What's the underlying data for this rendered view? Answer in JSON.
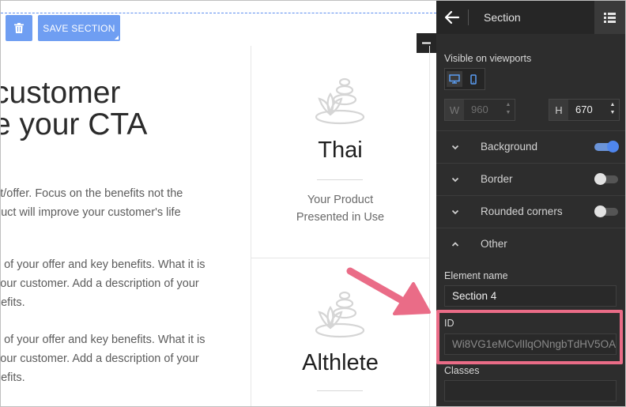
{
  "toolbar": {
    "save_label": "SAVE SECTION"
  },
  "canvas": {
    "headline_lines": [
      "customer",
      "e your CTA"
    ],
    "paragraphs": [
      [
        "ct/offer. Focus on the benefits not the",
        "duct will improve your customer's life"
      ],
      [
        "n of your offer and key benefits. What it is",
        "your customer. Add a description of your",
        "nefits."
      ],
      [
        "n of your offer and key benefits. What it is",
        "your customer. Add a description of your",
        "nefits."
      ]
    ],
    "cards": [
      {
        "title": "Thai",
        "subtitle_lines": [
          "Your Product",
          "Presented in Use"
        ]
      },
      {
        "title": "Althlete"
      }
    ]
  },
  "panel": {
    "title": "Section",
    "visible_on_viewports_label": "Visible on viewports",
    "width": {
      "label": "W",
      "value": "960"
    },
    "height": {
      "label": "H",
      "value": "670"
    },
    "accordions": [
      {
        "label": "Background",
        "toggle": "on",
        "expanded": false
      },
      {
        "label": "Border",
        "toggle": "off",
        "expanded": false
      },
      {
        "label": "Rounded corners",
        "toggle": "off",
        "expanded": false
      },
      {
        "label": "Other",
        "expanded": true
      }
    ],
    "element_name": {
      "label": "Element name",
      "value": "Section 4"
    },
    "id": {
      "label": "ID",
      "placeholder": "Wi8VG1eMCvlIlqONngbTdHV5OA"
    },
    "classes": {
      "label": "Classes",
      "value": ""
    }
  },
  "colors": {
    "accent_blue": "#6f9ef2",
    "panel_bg": "#2d2d2d",
    "annotation_pink": "#ea6c87"
  }
}
